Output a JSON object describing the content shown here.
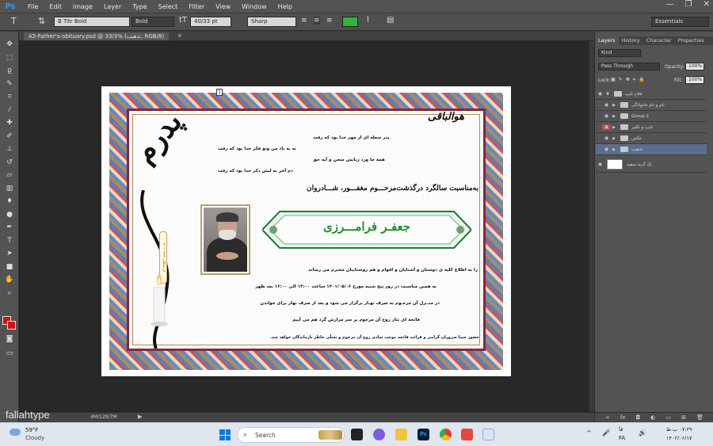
{
  "app": {
    "logo": "Ps",
    "menus": [
      "File",
      "Edit",
      "Image",
      "Layer",
      "Type",
      "Select",
      "Filter",
      "View",
      "Window",
      "Help"
    ],
    "window_controls": [
      "—",
      "❐",
      "✕"
    ]
  },
  "options_bar": {
    "font_family": "B Titr Bold",
    "font_style": "Bold",
    "font_size": "40/33 pt",
    "anti_alias": "Sharp",
    "workspace": "Essentials",
    "text_color": "#36b13a"
  },
  "document_tab": {
    "title": "A5-Father's-obituary.psd @ 33/3% (تذهیب, RGB/8)",
    "close": "×"
  },
  "status_bar": {
    "doc_size": "4M/129/7M",
    "arrow": "▶"
  },
  "watermark": "fallahtype",
  "document": {
    "big_word": "پدرم",
    "huva": "هوالباقی",
    "poem": [
      "پدر شعله ای از مهر خدا بود که رفت",
      "نه به یاد من وتو فکر خدا بود که رفت",
      "همه جا ورد زبانش سخن و آیه حق",
      "دم آخر به لبش ذکر خدا بود که رفت"
    ],
    "headline": "به‌مناسبت سالگرد درگذشت‌مرحـــوم مغفـــور، شـــادروان",
    "name": "جعفـر فرامـــرزی",
    "vertical_label": "ای سالگرد ۱۳۹۹-۱۴۰۱",
    "body": [
      "را به اطلاع کلیه ی دوستان و آشنایان و اقوام و هم روستاییان محترم می رساند",
      "به همین مناسبت در روز پنج شنبه مورخ ۱۴۰۱/۰۵/۰۶ ساعت ۱۴:۰۰ الی ۱۶:۰۰ بعد ظهر",
      "در منــزل آن مرحـوم به صرف نهـار برگزار می شود و بعد از صرف نهار برای خواندن",
      "فاتحه ای نثار روح آن مرحوم بر سر مزارش گرد هم می آییم",
      "حضور شما سروران گرامی و قرائت فاتحه موجب شادی روح آن مرحوم و تسلّی خاطر بازماندگان خواهد شد."
    ]
  },
  "layers_panel": {
    "tabs": [
      "Layers",
      "History",
      "Character",
      "Properties"
    ],
    "filter": "Kind",
    "blend_mode": "Pass Through",
    "opacity_label": "Opacity:",
    "opacity": "100%",
    "lock_label": "Lock:",
    "fill_label": "Fill:",
    "fill": "100%",
    "layers": [
      {
        "name": "فلاح تایپ",
        "type": "group",
        "open": true,
        "red_eye": false,
        "selected": false
      },
      {
        "name": "نام و نام خانوادگی",
        "type": "group",
        "open": false,
        "red_eye": false,
        "selected": false
      },
      {
        "name": "Group 2",
        "type": "group",
        "open": false,
        "red_eye": false,
        "selected": false
      },
      {
        "name": "تایپ و تکثیر",
        "type": "group",
        "open": false,
        "red_eye": true,
        "selected": false
      },
      {
        "name": "عکس",
        "type": "group",
        "open": false,
        "red_eye": false,
        "selected": false
      },
      {
        "name": "تذهیب",
        "type": "group",
        "open": false,
        "red_eye": false,
        "selected": true
      },
      {
        "name": "بک گرند سفید",
        "type": "layer",
        "open": false,
        "red_eye": false,
        "selected": false
      }
    ],
    "footer_icons": [
      "link-icon",
      "fx-icon",
      "mask-icon",
      "adjust-icon",
      "folder-icon",
      "new-layer-icon",
      "trash-icon"
    ],
    "footer_glyphs": [
      "∞",
      "fx",
      "◘",
      "◐",
      "▭",
      "⊞",
      "🗑"
    ]
  },
  "taskbar": {
    "weather_temp": "59°F",
    "weather_desc": "Cloudy",
    "search_placeholder": "Search",
    "language": "فا",
    "language2": "FA",
    "time": "۰۷:۲۹ ب.ظ",
    "date": "۱۴۰۲/۰۶/۱۷",
    "tray_chevron": "^",
    "tray_mic": "🎤",
    "tray_sound": "🔊"
  }
}
